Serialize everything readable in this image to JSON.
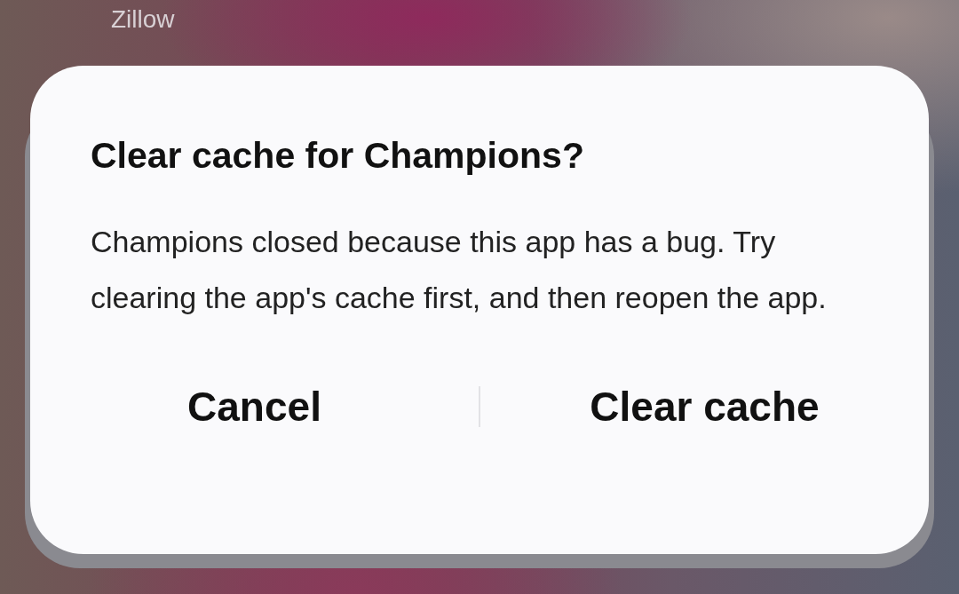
{
  "app_label": "Zillow",
  "dialog": {
    "title": "Clear cache for Champions?",
    "message": "Champions closed because this app has a bug. Try clearing the app's cache first, and then reopen the app.",
    "buttons": [
      {
        "label": "Cancel"
      },
      {
        "label": "Clear cache"
      }
    ]
  }
}
